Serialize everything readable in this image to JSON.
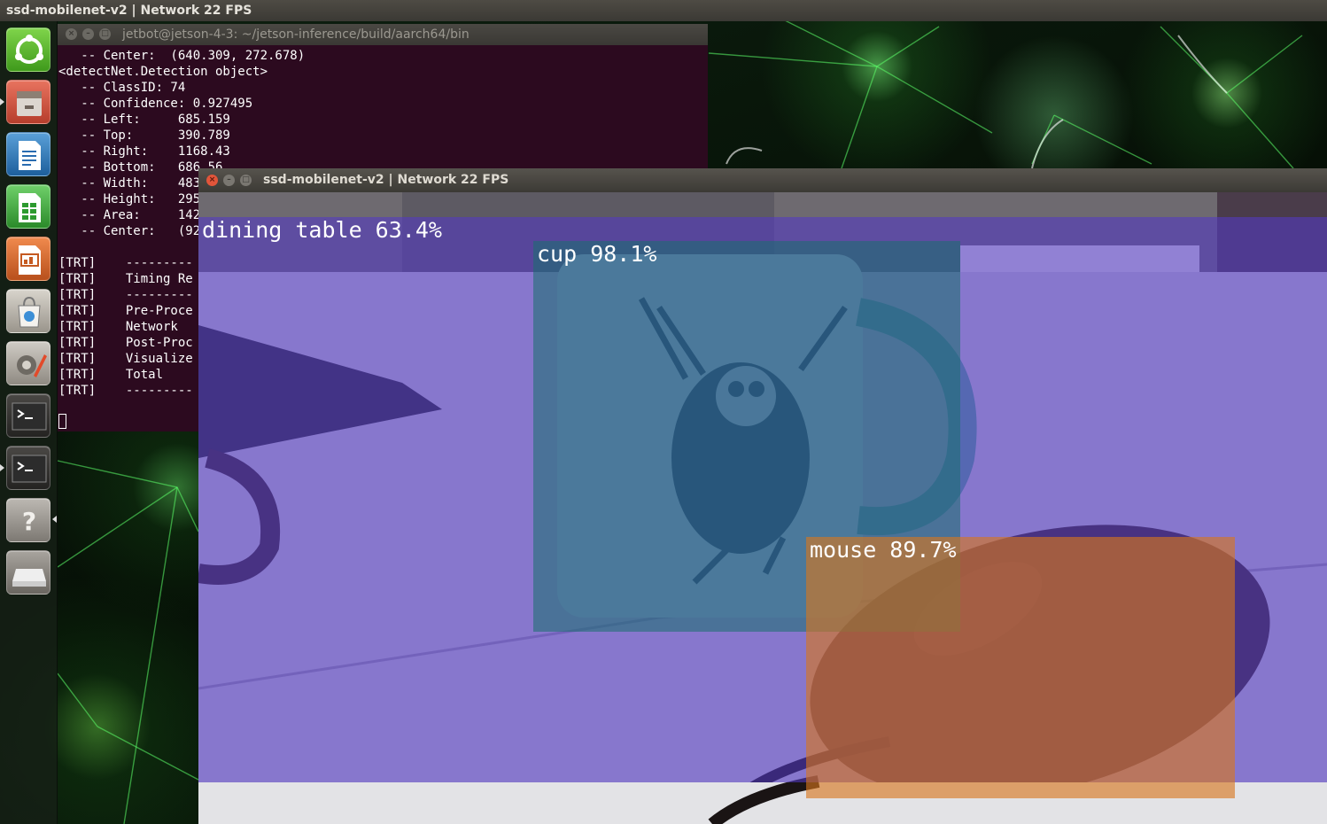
{
  "top_panel": {
    "title": "ssd-mobilenet-v2 | Network 22 FPS"
  },
  "launcher": {
    "items": [
      {
        "name": "ubuntu-dash-icon"
      },
      {
        "name": "files-icon"
      },
      {
        "name": "libreoffice-writer-icon"
      },
      {
        "name": "libreoffice-calc-icon"
      },
      {
        "name": "libreoffice-impress-icon"
      },
      {
        "name": "software-center-icon"
      },
      {
        "name": "system-settings-icon"
      },
      {
        "name": "terminal-icon"
      },
      {
        "name": "terminal-icon"
      },
      {
        "name": "help-icon"
      },
      {
        "name": "removable-drive-icon"
      }
    ]
  },
  "terminal": {
    "title": "jetbot@jetson-4-3: ~/jetson-inference/build/aarch64/bin",
    "lines": [
      "   -- Center:  (640.309, 272.678)",
      "<detectNet.Detection object>",
      "   -- ClassID: 74",
      "   -- Confidence: 0.927495",
      "   -- Left:     685.159",
      "   -- Top:      390.789",
      "   -- Right:    1168.43",
      "   -- Bottom:   686.56",
      "   -- Width:    483",
      "   -- Height:   295",
      "   -- Area:     142",
      "   -- Center:   (92",
      "",
      "[TRT]    ---------",
      "[TRT]    Timing Re",
      "[TRT]    ---------",
      "[TRT]    Pre-Proce",
      "[TRT]    Network",
      "[TRT]    Post-Proc",
      "[TRT]    Visualize",
      "[TRT]    Total",
      "[TRT]    ---------"
    ]
  },
  "detection_window": {
    "title": "ssd-mobilenet-v2 | Network 22 FPS",
    "detections": [
      {
        "label": "dining table 63.4%",
        "color": "#5a3cc8"
      },
      {
        "label": "cup 98.1%",
        "color": "#1e7a7a"
      },
      {
        "label": "mouse 89.7%",
        "color": "#d8781e"
      }
    ]
  }
}
